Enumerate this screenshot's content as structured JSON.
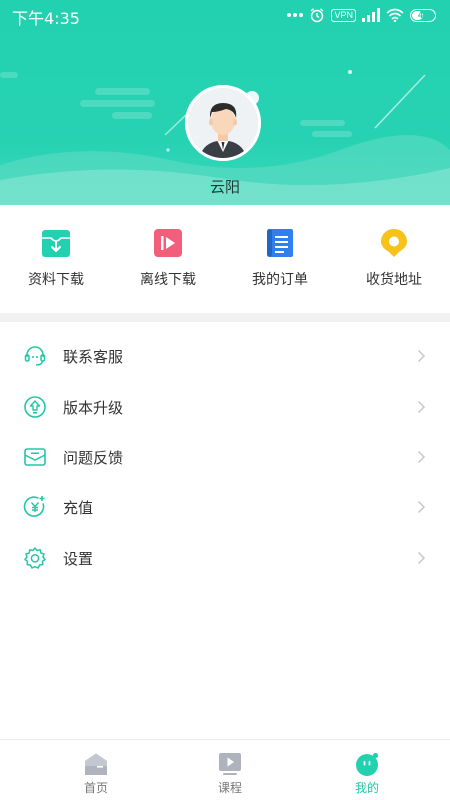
{
  "status_bar": {
    "time": "下午4:35",
    "vpn": "VPN",
    "battery": "47"
  },
  "profile": {
    "username": "云阳",
    "avatar_icon": "user-avatar-icon"
  },
  "quick_actions": [
    {
      "label": "资料下载",
      "icon": "download-box-icon",
      "color": "#22d1b0"
    },
    {
      "label": "离线下载",
      "icon": "video-play-icon",
      "color": "#f35f7a"
    },
    {
      "label": "我的订单",
      "icon": "order-scroll-icon",
      "color": "#2f80ed"
    },
    {
      "label": "收货地址",
      "icon": "location-pin-icon",
      "color": "#f7c21a"
    }
  ],
  "menu": [
    {
      "label": "联系客服",
      "icon": "customer-service-icon"
    },
    {
      "label": "版本升级",
      "icon": "upgrade-icon"
    },
    {
      "label": "问题反馈",
      "icon": "feedback-icon"
    },
    {
      "label": "充值",
      "icon": "recharge-icon"
    },
    {
      "label": "设置",
      "icon": "settings-gear-icon"
    }
  ],
  "bottom_nav": [
    {
      "label": "首页",
      "icon": "home-icon",
      "active": false
    },
    {
      "label": "课程",
      "icon": "course-icon",
      "active": false
    },
    {
      "label": "我的",
      "icon": "mine-icon",
      "active": true
    }
  ],
  "colors": {
    "accent": "#22d1b0",
    "menu_icon": "#22c7a6",
    "text": "#333333",
    "nav_inactive": "#777777"
  }
}
